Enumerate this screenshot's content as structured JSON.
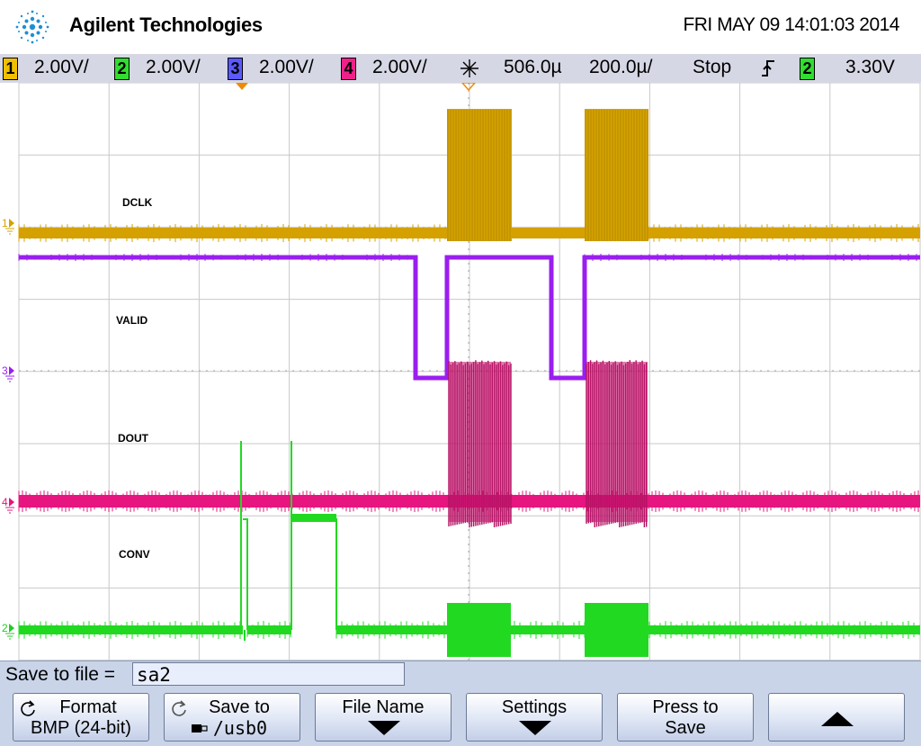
{
  "header": {
    "brand": "Agilent Technologies",
    "datetime": "FRI MAY 09 14:01:03 2014"
  },
  "status": {
    "channels": [
      {
        "num": "1",
        "scale": "2.00V/",
        "color": "#e0a800"
      },
      {
        "num": "2",
        "scale": "2.00V/",
        "color": "#22cc22"
      },
      {
        "num": "3",
        "scale": "2.00V/",
        "color": "#4a4aff"
      },
      {
        "num": "4",
        "scale": "2.00V/",
        "color": "#e8107a"
      }
    ],
    "trigger_position": "506.0µ",
    "timebase": "200.0µ/",
    "run_state": "Stop",
    "trigger_slope_icon": "rising-edge-icon",
    "trigger_channel": "2",
    "trigger_level": "3.30V"
  },
  "traces": {
    "dclk_label": "DCLK",
    "valid_label": "VALID",
    "dout_label": "DOUT",
    "conv_label": "CONV",
    "colors": {
      "ch1": "#d4a100",
      "ch2": "#22d922",
      "ch3": "#9a1ef0",
      "ch4": "#e6157f"
    }
  },
  "save": {
    "label": "Save to file =",
    "filename": "sa2"
  },
  "softkeys": {
    "format_line1": "Format",
    "format_line2": "BMP (24-bit)",
    "saveto_line1": "Save to",
    "saveto_line2": "/usb0",
    "filename_label": "File Name",
    "settings_label": "Settings",
    "press_line1": "Press to",
    "press_line2": "Save"
  }
}
